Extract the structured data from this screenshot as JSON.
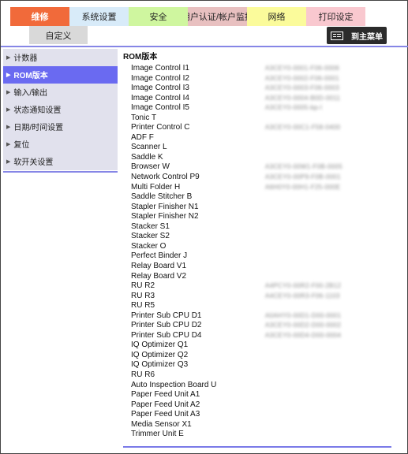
{
  "tabs": [
    {
      "label": "维修",
      "bg": "#f16a3a",
      "active": true
    },
    {
      "label": "系统设置",
      "bg": "#d8ebf9",
      "active": false
    },
    {
      "label": "安全",
      "bg": "#cff69f",
      "active": false
    },
    {
      "label": "用户认证/帐户监控",
      "bg": "#e8c0c0",
      "active": false
    },
    {
      "label": "网络",
      "bg": "#fbfb9b",
      "active": false
    },
    {
      "label": "打印设定",
      "bg": "#f9c8cf",
      "active": false
    }
  ],
  "subtab": {
    "label": "自定义"
  },
  "top_menu": {
    "label": "到主菜单",
    "icon": "menu-grid-icon"
  },
  "sidebar": {
    "items": [
      {
        "label": "计数器",
        "active": false
      },
      {
        "label": "ROM版本",
        "active": true
      },
      {
        "label": "输入/输出",
        "active": false
      },
      {
        "label": "状态通知设置",
        "active": false
      },
      {
        "label": "日期/时间设置",
        "active": false
      },
      {
        "label": "复位",
        "active": false
      },
      {
        "label": "软开关设置",
        "active": false
      }
    ]
  },
  "main": {
    "title": "ROM版本",
    "rows": [
      {
        "name": "Image Control I1",
        "version": "A3CEY0-0001-F06-0006"
      },
      {
        "name": "Image Control I2",
        "version": "A3CEY0-0002-F06-0001"
      },
      {
        "name": "Image Control I3",
        "version": "A3CEY0-0003-F06-0003"
      },
      {
        "name": "Image Control I4",
        "version": "A3CEY0-0004-B0D-0011"
      },
      {
        "name": "Image Control I5",
        "version": "A3CEY0-0005-bp-l"
      },
      {
        "name": "Tonic T",
        "version": ""
      },
      {
        "name": "Printer Control C",
        "version": "A3CEY0-00C1-F58-0400"
      },
      {
        "name": "ADF F",
        "version": ""
      },
      {
        "name": "Scanner L",
        "version": ""
      },
      {
        "name": "Saddle K",
        "version": ""
      },
      {
        "name": "Browser W",
        "version": "A3CEY0-00W1-F0B-0005"
      },
      {
        "name": "Network Control P9",
        "version": "A3CEY0-00P9-F0B-0001"
      },
      {
        "name": "Multi Folder H",
        "version": "A6H0Y0-00H1-F25-000E"
      },
      {
        "name": "Saddle Stitcher B",
        "version": ""
      },
      {
        "name": "Stapler Finisher N1",
        "version": ""
      },
      {
        "name": "Stapler Finisher N2",
        "version": ""
      },
      {
        "name": "Stacker S1",
        "version": ""
      },
      {
        "name": "Stacker S2",
        "version": ""
      },
      {
        "name": "Stacker O",
        "version": ""
      },
      {
        "name": "Perfect Binder J",
        "version": ""
      },
      {
        "name": "Relay Board V1",
        "version": ""
      },
      {
        "name": "Relay Board V2",
        "version": ""
      },
      {
        "name": "RU R2",
        "version": "A4PCY0-00R2-F00-2B12"
      },
      {
        "name": "RU R3",
        "version": "A4CEY0-00R3-F06-1103"
      },
      {
        "name": "RU R5",
        "version": ""
      },
      {
        "name": "Printer Sub CPU D1",
        "version": "A0AHY0-00D1-D00-0001"
      },
      {
        "name": "Printer Sub CPU D2",
        "version": "A3CEY0-00D2-D00-0002"
      },
      {
        "name": "Printer Sub CPU D4",
        "version": "A3CEY0-00D4-D00-0004"
      },
      {
        "name": "IQ Optimizer Q1",
        "version": ""
      },
      {
        "name": "IQ Optimizer Q2",
        "version": ""
      },
      {
        "name": "IQ Optimizer Q3",
        "version": ""
      },
      {
        "name": "RU R6",
        "version": ""
      },
      {
        "name": "Auto Inspection Board U",
        "version": ""
      },
      {
        "name": "Paper Feed Unit A1",
        "version": ""
      },
      {
        "name": "Paper Feed Unit A2",
        "version": ""
      },
      {
        "name": "Paper Feed Unit A3",
        "version": ""
      },
      {
        "name": "Media Sensor X1",
        "version": ""
      },
      {
        "name": "Trimmer Unit E",
        "version": ""
      }
    ]
  }
}
